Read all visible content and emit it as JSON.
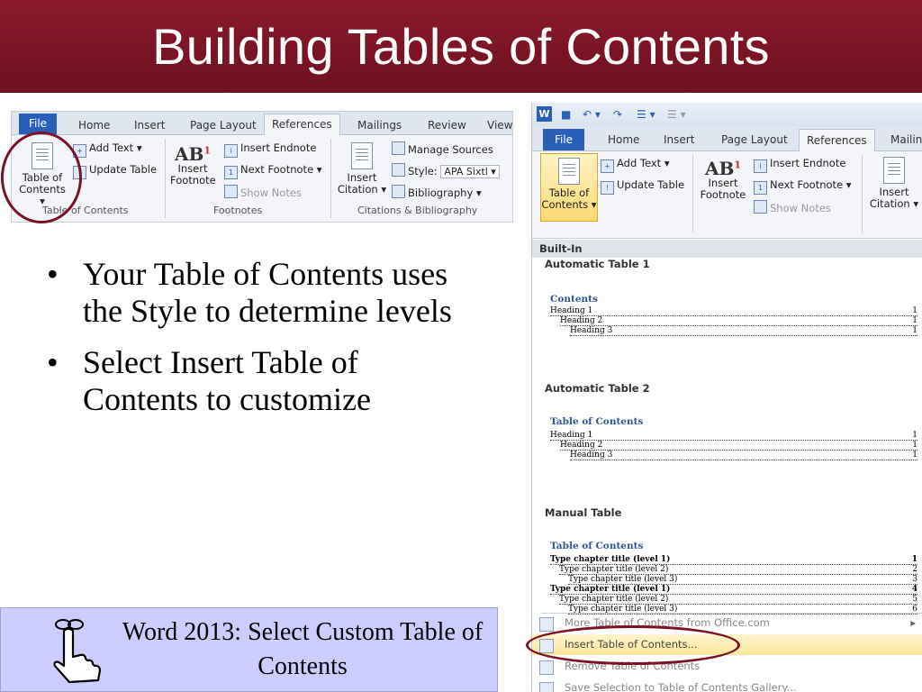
{
  "slide": {
    "title": "Building Tables of Contents",
    "bullets": [
      "Your Table of Contents uses the Style to determine levels",
      "Select Insert Table of Contents to customize"
    ],
    "note": "Word 2013: Select Custom Table of Contents"
  },
  "left_ribbon": {
    "tabs": [
      "File",
      "Home",
      "Insert",
      "Page Layout",
      "References",
      "Mailings",
      "Review",
      "View"
    ],
    "active_tab": "References",
    "toc_button": "Table of\nContents",
    "toc_line1": "Table of",
    "toc_line2": "Contents ▾",
    "add_text": "Add Text ▾",
    "update_table": "Update Table",
    "insert_footnote_l1": "Insert",
    "insert_footnote_l2": "Footnote",
    "insert_endnote": "Insert Endnote",
    "next_footnote": "Next Footnote ▾",
    "show_notes": "Show Notes",
    "insert_citation_l1": "Insert",
    "insert_citation_l2": "Citation ▾",
    "manage_sources": "Manage Sources",
    "style_label": "Style:",
    "style_value": "APA Sixtl ▾",
    "bibliography": "Bibliography ▾",
    "group_toc": "Table of Contents",
    "group_footnotes": "Footnotes",
    "group_citations": "Citations & Bibliography",
    "ab_text": "AB",
    "ab_sup": "1"
  },
  "right_shot": {
    "tabs": [
      "File",
      "Home",
      "Insert",
      "Page Layout",
      "References",
      "Mailin"
    ],
    "active_tab": "References",
    "toc_line1": "Table of",
    "toc_line2": "Contents ▾",
    "add_text": "Add Text ▾",
    "update_table": "Update Table",
    "insert_footnote_l1": "Insert",
    "insert_footnote_l2": "Footnote",
    "insert_endnote": "Insert Endnote",
    "next_footnote": "Next Footnote ▾",
    "show_notes": "Show Notes",
    "insert_citation_l1": "Insert",
    "insert_citation_l2": "Citation ▾",
    "ab_text": "AB",
    "ab_sup": "1",
    "builtin": "Built-In",
    "gallery": [
      {
        "name": "Automatic Table 1",
        "heading": "Contents",
        "lines": [
          {
            "text": "Heading 1",
            "page": "1",
            "indent": 0
          },
          {
            "text": "Heading 2",
            "page": "1",
            "indent": 1
          },
          {
            "text": "Heading 3",
            "page": "1",
            "indent": 2
          }
        ]
      },
      {
        "name": "Automatic Table 2",
        "heading": "Table of Contents",
        "lines": [
          {
            "text": "Heading 1",
            "page": "1",
            "indent": 0
          },
          {
            "text": "Heading 2",
            "page": "1",
            "indent": 1
          },
          {
            "text": "Heading 3",
            "page": "1",
            "indent": 2
          }
        ]
      },
      {
        "name": "Manual Table",
        "heading": "Table of Contents",
        "lines": [
          {
            "text": "Type chapter title (level 1)",
            "page": "1",
            "indent": 0,
            "bold": true
          },
          {
            "text": "Type chapter title (level 2)",
            "page": "2",
            "indent": 1
          },
          {
            "text": "Type chapter title (level 3)",
            "page": "3",
            "indent": 2
          },
          {
            "text": "Type chapter title (level 1)",
            "page": "4",
            "indent": 0,
            "bold": true
          },
          {
            "text": "Type chapter title (level 2)",
            "page": "5",
            "indent": 1
          },
          {
            "text": "Type chapter title (level 3)",
            "page": "6",
            "indent": 2
          }
        ]
      }
    ],
    "menu_items": [
      {
        "label": "More Table of Contents from Office.com",
        "state": "dim-arrow"
      },
      {
        "label": "Insert Table of Contents...",
        "state": "highlight"
      },
      {
        "label": "Remove Table of Contents",
        "state": "dim"
      },
      {
        "label": "Save Selection to Table of Contents Gallery...",
        "state": "dim"
      }
    ]
  },
  "colors": {
    "title_bar": "#7a1326",
    "note_box": "#ccccff",
    "circle": "#7a1326",
    "word_blue": "#2a5fb8",
    "highlight": "#fde79a"
  },
  "icons": [
    "document-icon",
    "add-text-icon",
    "update-table-icon",
    "endnote-icon",
    "footnote-icon",
    "citation-icon",
    "manage-sources-icon",
    "style-icon",
    "bibliography-icon",
    "hand-pointer-icon",
    "word-logo-icon",
    "save-icon",
    "undo-icon",
    "redo-icon"
  ]
}
